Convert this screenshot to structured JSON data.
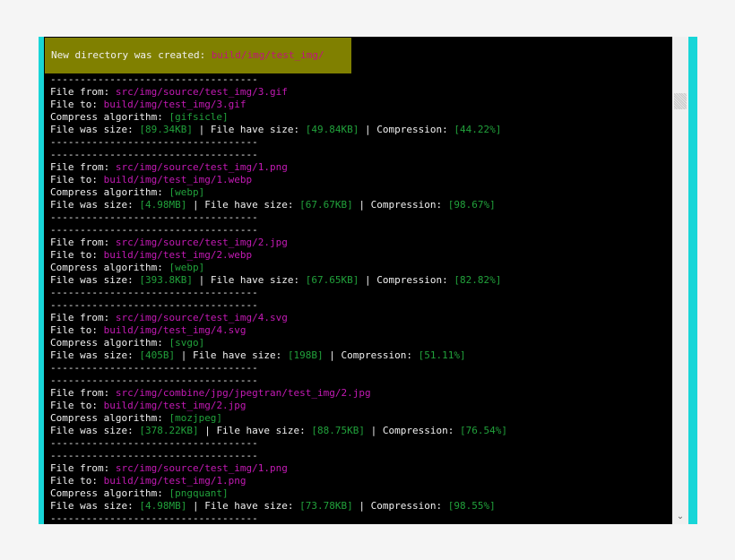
{
  "banner": {
    "label": "New directory was created: ",
    "path": "build/img/test_img/"
  },
  "separator": "-----------------------------------",
  "labels": {
    "file_from": "File from: ",
    "file_to": "File to: ",
    "algorithm": "Compress algorithm: ",
    "was_size": "File was size: ",
    "have_size": " | File have size: ",
    "compression": " | Compression: "
  },
  "entries": [
    {
      "from": "src/img/source/test_img/3.gif",
      "to": "build/img/test_img/3.gif",
      "algorithm": "[gifsicle]",
      "was": "[89.34KB]",
      "have": "[49.84KB]",
      "compression": "[44.22%]"
    },
    {
      "from": "src/img/source/test_img/1.png",
      "to": "build/img/test_img/1.webp",
      "algorithm": "[webp]",
      "was": "[4.98MB]",
      "have": "[67.67KB]",
      "compression": "[98.67%]"
    },
    {
      "from": "src/img/source/test_img/2.jpg",
      "to": "build/img/test_img/2.webp",
      "algorithm": "[webp]",
      "was": "[393.8KB]",
      "have": "[67.65KB]",
      "compression": "[82.82%]"
    },
    {
      "from": "src/img/source/test_img/4.svg",
      "to": "build/img/test_img/4.svg",
      "algorithm": "[svgo]",
      "was": "[405B]",
      "have": "[198B]",
      "compression": "[51.11%]"
    },
    {
      "from": "src/img/combine/jpg/jpegtran/test_img/2.jpg",
      "to": "build/img/test_img/2.jpg",
      "algorithm": "[mozjpeg]",
      "was": "[378.22KB]",
      "have": "[88.75KB]",
      "compression": "[76.54%]"
    },
    {
      "from": "src/img/source/test_img/1.png",
      "to": "build/img/test_img/1.png",
      "algorithm": "[pngquant]",
      "was": "[4.98MB]",
      "have": "[73.78KB]",
      "compression": "[98.55%]"
    }
  ],
  "colors": {
    "terminal_bg": "#000000",
    "banner_bg": "#808000",
    "path_magenta": "#c31ab4",
    "value_green": "#21a13b",
    "frame_cyan": "#18d6d8"
  },
  "icons": {
    "scroll_down": "chevron-down-icon"
  }
}
